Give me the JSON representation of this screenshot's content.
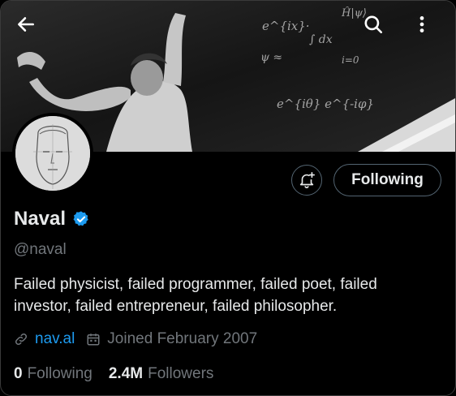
{
  "header": {
    "back_icon": "arrow-left-icon",
    "search_icon": "search-icon",
    "more_icon": "more-vertical-icon"
  },
  "banner": {
    "scribbles": [
      "e^{ix}·",
      "∫ dx",
      "ψ ≈",
      "i=0",
      "e^{iθ} e^{-iφ}",
      "Ĥ|ψ⟩"
    ]
  },
  "profile": {
    "name": "Naval",
    "handle": "@naval",
    "verified": true,
    "bio": "Failed physicist, failed programmer, failed poet, failed investor, failed entrepreneur, failed philosopher.",
    "link_text": "nav.al",
    "joined": "Joined February 2007"
  },
  "actions": {
    "notify_icon": "bell-plus-icon",
    "follow_label": "Following"
  },
  "stats": {
    "following_count": "0",
    "following_label": "Following",
    "followers_count": "2.4M",
    "followers_label": "Followers"
  },
  "colors": {
    "background": "#000000",
    "text": "#e7e9ea",
    "muted": "#71767b",
    "accent": "#1d9bf0",
    "border": "#536471"
  }
}
